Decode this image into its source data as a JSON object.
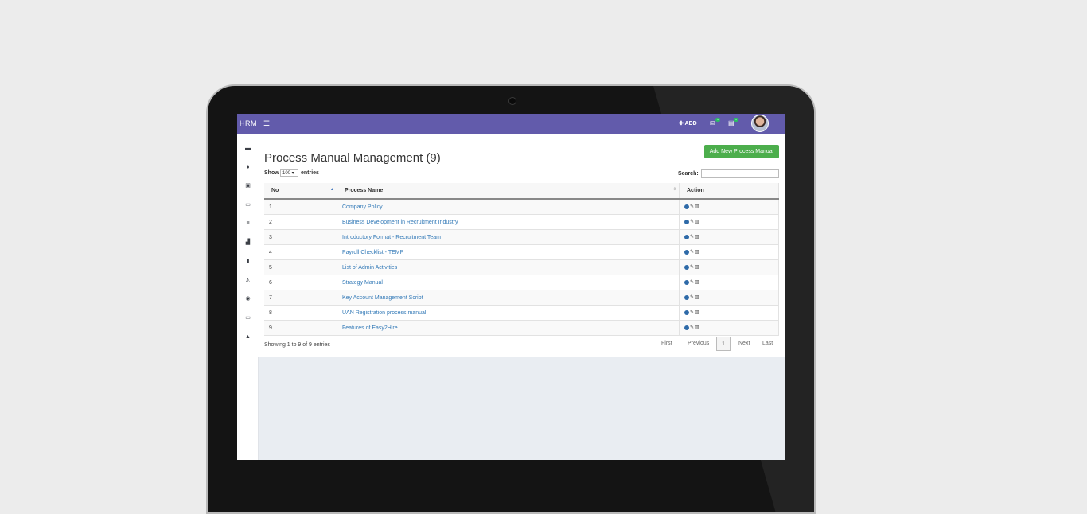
{
  "topbar": {
    "brand": "HRM",
    "menu_icon": "hamburger-icon",
    "add_label": "✚ ADD",
    "mail_icon": "envelope-icon",
    "mail_badge": "3",
    "doc_icon": "list-icon",
    "doc_badge": "1",
    "avatar": "user-avatar"
  },
  "sidebar": {
    "icons": [
      "folder-icon",
      "user-icon",
      "phone-icon",
      "money-icon",
      "list-icon",
      "signal-icon",
      "file-icon",
      "graduation-icon",
      "eye-icon",
      "money-icon",
      "lock-icon"
    ],
    "glyphs": [
      "▬",
      "●",
      "▣",
      "▭",
      "≡",
      "▟",
      "▮",
      "◭",
      "◉",
      "▭",
      "▲"
    ]
  },
  "page": {
    "title": "Process Manual Management (9)",
    "add_button": "Add New Process Manual"
  },
  "table_controls": {
    "show_label": "Show",
    "length_value": "100 ▾",
    "entries_label": "entries",
    "search_label": "Search:",
    "search_value": ""
  },
  "table": {
    "columns": [
      "No",
      "Process Name",
      "Action"
    ],
    "rows": [
      {
        "no": "1",
        "name": "Company Policy"
      },
      {
        "no": "2",
        "name": "Business Development in Recruitment Industry"
      },
      {
        "no": "3",
        "name": "Introductory Format - Recruitment Team"
      },
      {
        "no": "4",
        "name": "Payroll Checklist - TEMP"
      },
      {
        "no": "5",
        "name": "List of Admin Activities"
      },
      {
        "no": "6",
        "name": "Strategy Manual"
      },
      {
        "no": "7",
        "name": "Key Account Management Script"
      },
      {
        "no": "8",
        "name": "UAN Registration process manual"
      },
      {
        "no": "9",
        "name": "Features of Easy2Hire"
      }
    ],
    "action_icons": [
      "view-icon",
      "edit-icon",
      "trash-icon"
    ]
  },
  "footer": {
    "info": "Showing 1 to 9 of 9 entries",
    "pagination": {
      "first": "First",
      "previous": "Previous",
      "current": "1",
      "next": "Next",
      "last": "Last"
    }
  }
}
